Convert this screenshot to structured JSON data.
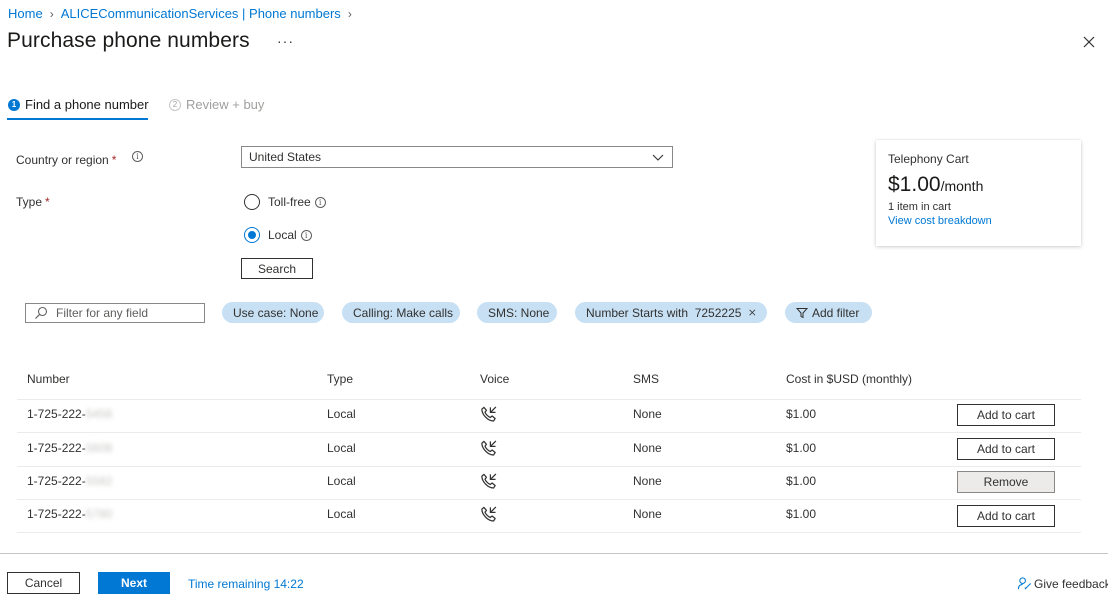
{
  "breadcrumb": {
    "home": "Home",
    "resource": "ALICECommunicationServices | Phone numbers"
  },
  "page": {
    "title": "Purchase phone numbers",
    "more": "···",
    "close_icon": "close-icon"
  },
  "steps": [
    {
      "number": "1",
      "label": "Find a phone number",
      "active": true
    },
    {
      "number": "2",
      "label": "Review + buy",
      "active": false
    }
  ],
  "form": {
    "country_label": "Country or region",
    "country_value": "United States",
    "type_label": "Type",
    "required_mark": "*",
    "info_glyph": "i",
    "options": [
      {
        "label": "Toll-free",
        "checked": false
      },
      {
        "label": "Local",
        "checked": true
      }
    ],
    "search_label": "Search"
  },
  "cart": {
    "title": "Telephony Cart",
    "price": "$1.00",
    "per": "/month",
    "items": "1 item in cart",
    "link": "View cost breakdown"
  },
  "filters": {
    "placeholder": "Filter for any field",
    "pills": {
      "use_case": "Use case: None",
      "calling": "Calling: Make calls",
      "sms": "SMS: None",
      "starts_with": "Number Starts with  7252225",
      "add_filter": "Add filter"
    }
  },
  "table": {
    "headers": {
      "number": "Number",
      "type": "Type",
      "voice": "Voice",
      "sms": "SMS",
      "cost": "Cost in $USD (monthly)"
    },
    "rows": [
      {
        "number_prefix": "1-725-222-",
        "number_hidden": "5456",
        "type": "Local",
        "voice_icon": "phone-call-icon",
        "sms": "None",
        "cost": "$1.00",
        "action": "Add to cart"
      },
      {
        "number_prefix": "1-725-222-",
        "number_hidden": "5608",
        "type": "Local",
        "voice_icon": "phone-call-icon",
        "sms": "None",
        "cost": "$1.00",
        "action": "Add to cart"
      },
      {
        "number_prefix": "1-725-222-",
        "number_hidden": "5582",
        "type": "Local",
        "voice_icon": "phone-call-icon",
        "sms": "None",
        "cost": "$1.00",
        "action": "Remove"
      },
      {
        "number_prefix": "1-725-222-",
        "number_hidden": "5780",
        "type": "Local",
        "voice_icon": "phone-call-icon",
        "sms": "None",
        "cost": "$1.00",
        "action": "Add to cart"
      }
    ]
  },
  "footer": {
    "cancel": "Cancel",
    "next": "Next",
    "time_remaining": "Time remaining 14:22",
    "feedback": "Give feedback"
  },
  "colors": {
    "accent": "#0078d4",
    "pill": "#c7e0f4",
    "required": "#a4262c"
  }
}
